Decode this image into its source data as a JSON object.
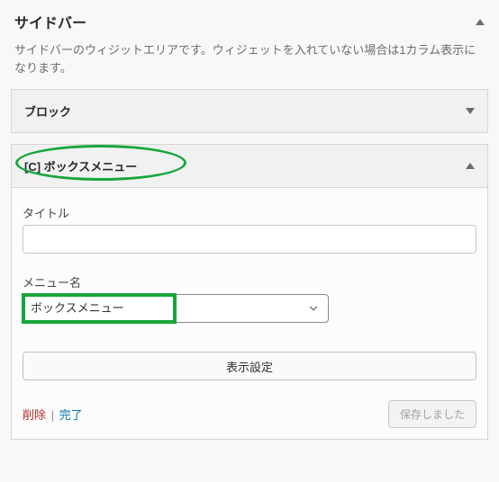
{
  "area": {
    "title": "サイドバー",
    "description": "サイドバーのウィジットエリアです。ウィジェットを入れていない場合は1カラム表示になります。"
  },
  "widgets": {
    "block": {
      "title": "ブロック"
    },
    "box_menu": {
      "title": "[C] ボックスメニュー",
      "fields": {
        "title_label": "タイトル",
        "title_value": "",
        "menu_label": "メニュー名",
        "menu_selected": "ボックスメニュー"
      },
      "display_settings_label": "表示設定",
      "actions": {
        "delete": "削除",
        "done": "完了",
        "saved": "保存しました"
      }
    }
  }
}
